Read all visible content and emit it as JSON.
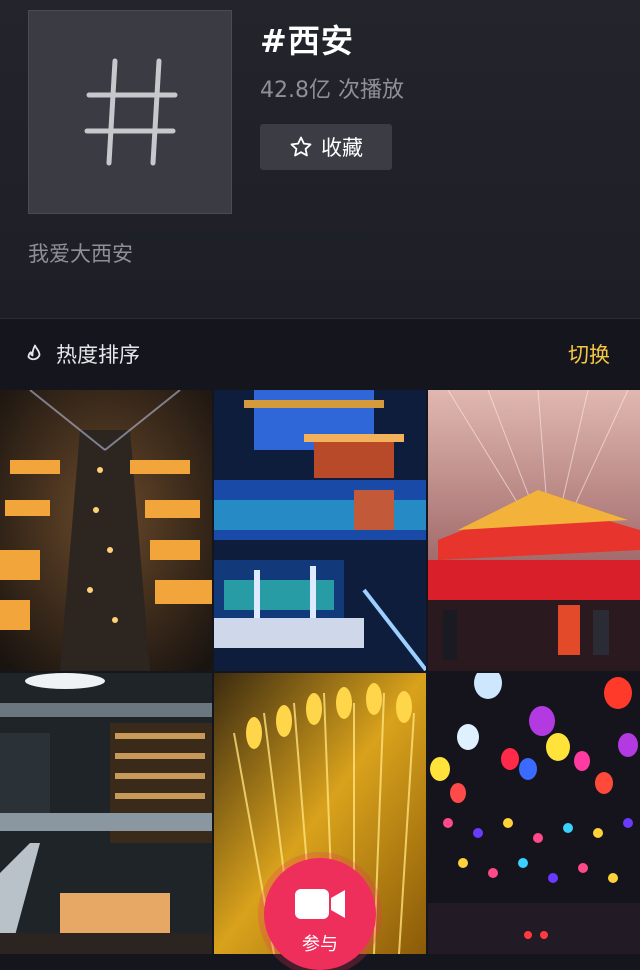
{
  "topic": {
    "title": "#西安",
    "play_count": "42.8亿 次播放",
    "favorite_label": "收藏",
    "description": "我爱大西安",
    "cover_icon": "hashtag-icon"
  },
  "sort_bar": {
    "label": "热度排序",
    "icon": "flame-icon",
    "switch_label": "切换"
  },
  "join": {
    "label": "参与",
    "icon": "video-camera-icon"
  },
  "colors": {
    "accent_yellow": "#f6c543",
    "join_red": "#ee2f5b",
    "background": "#15161d"
  }
}
